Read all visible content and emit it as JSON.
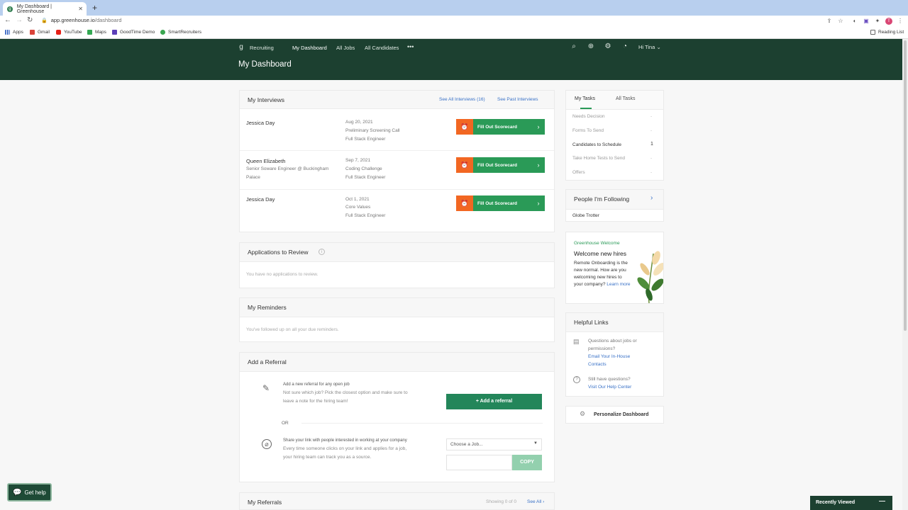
{
  "browser": {
    "tab_title": "My Dashboard | Greenhouse",
    "url_host": "app.greenhouse.io",
    "url_path": "/dashboard",
    "bookmarks": [
      "Apps",
      "Gmail",
      "YouTube",
      "Maps",
      "GoodTime Demo",
      "SmartRecruiters"
    ],
    "reading_list": "Reading List"
  },
  "header": {
    "brand": "Recruiting",
    "nav": [
      "My Dashboard",
      "All Jobs",
      "All Candidates"
    ],
    "more": "•••",
    "user": "Hi Tina",
    "page_title": "My Dashboard"
  },
  "interviews": {
    "title": "My Interviews",
    "see_all": "See All Interviews (16)",
    "see_past": "See Past Interviews",
    "button_label": "Fill Out Scorecard",
    "items": [
      {
        "name": "Jessica Day",
        "subtitle": "",
        "subtitle2": "",
        "date": "Aug 20, 2021",
        "stage": "Preliminary Screening Call",
        "job": "Full Stack Engineer"
      },
      {
        "name": "Queen Elizabeth",
        "subtitle": "Senior Soware Engineer @ Buckingham",
        "subtitle2": "Palace",
        "date": "Sep 7, 2021",
        "stage": "Coding Challenge",
        "job": "Full Stack Engineer"
      },
      {
        "name": "Jessica Day",
        "subtitle": "",
        "subtitle2": "",
        "date": "Oct 1, 2021",
        "stage": "Core Values",
        "job": "Full Stack Engineer"
      }
    ]
  },
  "applications": {
    "title": "Applications to Review",
    "empty": "You have no applications to review."
  },
  "reminders": {
    "title": "My Reminders",
    "empty": "You've followed up on all your due reminders."
  },
  "referral": {
    "title": "Add a Referral",
    "line1": "Add a new referral for any open job",
    "line2": "Not sure which job? Pick the closest option and make sure to",
    "line3": "leave a note for the hiring team!",
    "add_button": "+ Add a referral",
    "or": "OR",
    "share1": "Share your link with people interested in working at your company",
    "share2": "Every time someone clicks on your link and applies for a job,",
    "share3": "your hiring team can track you as a source.",
    "select_placeholder": "Choose a Job...",
    "copy": "COPY"
  },
  "my_referrals": {
    "title": "My Referrals",
    "showing": "Showing 0 of 0",
    "see_all": "See All"
  },
  "tasks": {
    "tabs": [
      "My Tasks",
      "All Tasks"
    ],
    "items": [
      {
        "label": "Needs Decision",
        "value": "-"
      },
      {
        "label": "Forms To Send",
        "value": "-"
      },
      {
        "label": "Candidates to Schedule",
        "value": "1"
      },
      {
        "label": "Take Home Tests to Send",
        "value": "-"
      },
      {
        "label": "Offers",
        "value": "-"
      }
    ]
  },
  "following": {
    "title": "People I'm Following",
    "items": [
      "Globe Trotter"
    ]
  },
  "welcome": {
    "kicker": "Greenhouse Welcome",
    "title": "Welcome new hires",
    "body1": "Remote Onboarding is the",
    "body2": "new normal. How are you",
    "body3": "welcoming new hires to",
    "body4": "your company?",
    "learn_more": "Learn more"
  },
  "helpful": {
    "title": "Helpful Links",
    "q1a": "Questions about jobs or",
    "q1b": "permissions?",
    "link1a": "Email Your In-House",
    "link1b": "Contacts",
    "q2": "Still have questions?",
    "link2": "Visit Our Help Center"
  },
  "personalize": "Personalize Dashboard",
  "get_help": "Get help",
  "recently_viewed": "Recently Viewed",
  "colors": {
    "header": "#1c4030",
    "green": "#2a9a57",
    "orange": "#f26722",
    "link": "#3a72c7"
  }
}
